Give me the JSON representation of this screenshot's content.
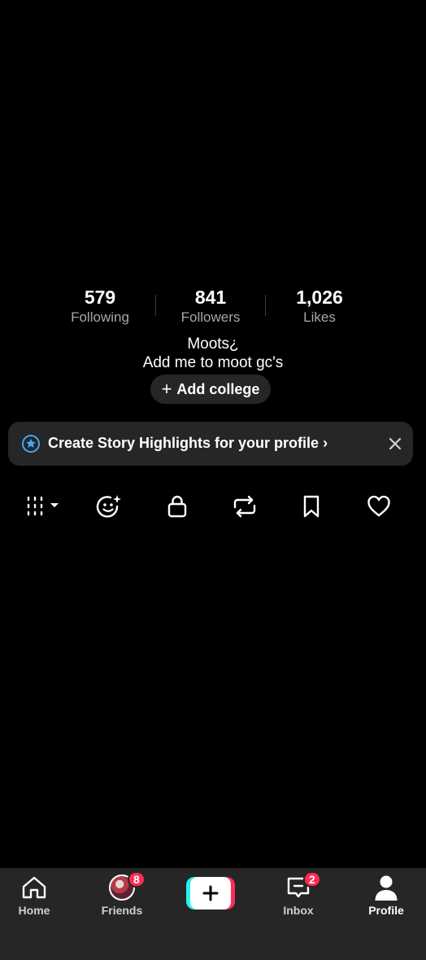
{
  "stats": {
    "following": {
      "value": "579",
      "label": "Following"
    },
    "followers": {
      "value": "841",
      "label": "Followers"
    },
    "likes": {
      "value": "1,026",
      "label": "Likes"
    }
  },
  "bio": {
    "line1": "Moots¿",
    "line2": "Add me to moot gc's"
  },
  "add_college": {
    "plus": "+",
    "label": "Add college"
  },
  "banner": {
    "icon": "star-circle-icon",
    "text": "Create Story Highlights for your profile",
    "chevron": "›",
    "close_icon": "close-icon"
  },
  "tabs": [
    {
      "icon": "grid-dropdown-icon",
      "active": true
    },
    {
      "icon": "sparkle-face-icon"
    },
    {
      "icon": "lock-icon"
    },
    {
      "icon": "repost-icon"
    },
    {
      "icon": "bookmark-icon"
    },
    {
      "icon": "heart-icon"
    }
  ],
  "nav": {
    "home": {
      "label": "Home",
      "icon": "home-icon"
    },
    "friends": {
      "label": "Friends",
      "badge": "8",
      "icon": "avatar"
    },
    "create": {
      "icon": "plus-icon"
    },
    "inbox": {
      "label": "Inbox",
      "badge": "2",
      "icon": "inbox-icon"
    },
    "profile": {
      "label": "Profile",
      "icon": "person-icon",
      "active": true
    }
  },
  "colors": {
    "background": "#000000",
    "surface": "#262626",
    "muted_text": "#a7a7a7",
    "badge": "#fe2c55",
    "accent_cyan": "#25f4ee",
    "star_blue": "#3fa9f5"
  }
}
